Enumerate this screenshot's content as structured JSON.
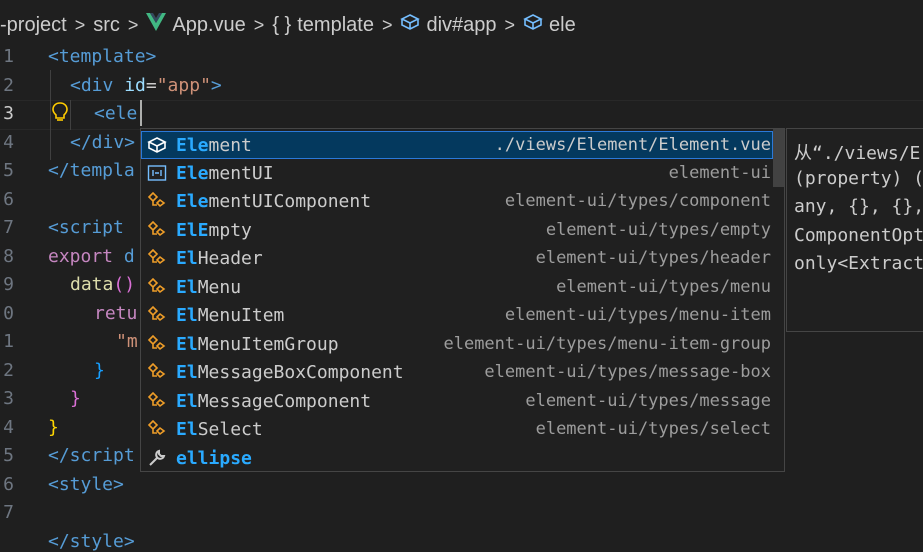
{
  "breadcrumb": {
    "project": "-project",
    "folder": "src",
    "file": "App.vue",
    "node1": "template",
    "node2": "div#app",
    "node3": "ele"
  },
  "line_numbers": [
    "1",
    "2",
    "3",
    "4",
    "5",
    "6",
    "7",
    "8",
    "9",
    "0",
    "1",
    "2",
    "3",
    "4",
    "5",
    "6",
    "7"
  ],
  "code": {
    "l1": "<template>",
    "l2_open": "<div ",
    "l2_attr": "id",
    "l2_eq": "=",
    "l2_val": "\"app\"",
    "l2_close": ">",
    "l3": "<ele",
    "l4_close_div": "</div>",
    "l5": "</templa",
    "l7": "<script",
    "l8_kw": "export",
    "l8_rest": " d",
    "l9_fn": "data",
    "l9_rest": "()",
    "l10": "retu",
    "l11": "\"m",
    "l12": "}",
    "l13": "}",
    "l14": "}",
    "l15": "</script",
    "l16": "<style>",
    "l18": "</style>"
  },
  "suggestions": [
    {
      "pre": "Ele",
      "rest": "ment",
      "detail": "./views/Element/Element.vue",
      "icon": "module-icon"
    },
    {
      "pre": "Ele",
      "rest": "mentUI",
      "detail": "element-ui",
      "icon": "variable-icon"
    },
    {
      "pre": "Ele",
      "rest": "mentUIComponent",
      "detail": "element-ui/types/component",
      "icon": "class-icon"
    },
    {
      "pre": "ElE",
      "rest": "mpty",
      "detail": "element-ui/types/empty",
      "icon": "class-icon"
    },
    {
      "pre": "El",
      "rest": "Header",
      "detail": "element-ui/types/header",
      "icon": "class-icon"
    },
    {
      "pre": "El",
      "rest": "Menu",
      "detail": "element-ui/types/menu",
      "icon": "class-icon"
    },
    {
      "pre": "El",
      "rest": "MenuItem",
      "detail": "element-ui/types/menu-item",
      "icon": "class-icon"
    },
    {
      "pre": "El",
      "rest": "MenuItemGroup",
      "detail": "element-ui/types/menu-item-group",
      "icon": "class-icon"
    },
    {
      "pre": "El",
      "rest": "MessageBoxComponent",
      "detail": "element-ui/types/message-box",
      "icon": "class-icon"
    },
    {
      "pre": "El",
      "rest": "MessageComponent",
      "detail": "element-ui/types/message",
      "icon": "class-icon"
    },
    {
      "pre": "El",
      "rest": "Select",
      "detail": "element-ui/types/select",
      "icon": "class-icon"
    },
    {
      "pre": "e",
      "rest": "llipse",
      "detail": "",
      "icon": "wrench-icon"
    }
  ],
  "details": {
    "l1": "从“./views/E",
    "l2": "(property) (",
    "l3": "any, {}, {},",
    "l4": "ComponentOpt",
    "l5": "only<Extract"
  },
  "colors": {
    "selection": "#04395e",
    "match": "#2aaaff",
    "class_icon": "#ee9d28",
    "vue_green": "#41b883"
  }
}
